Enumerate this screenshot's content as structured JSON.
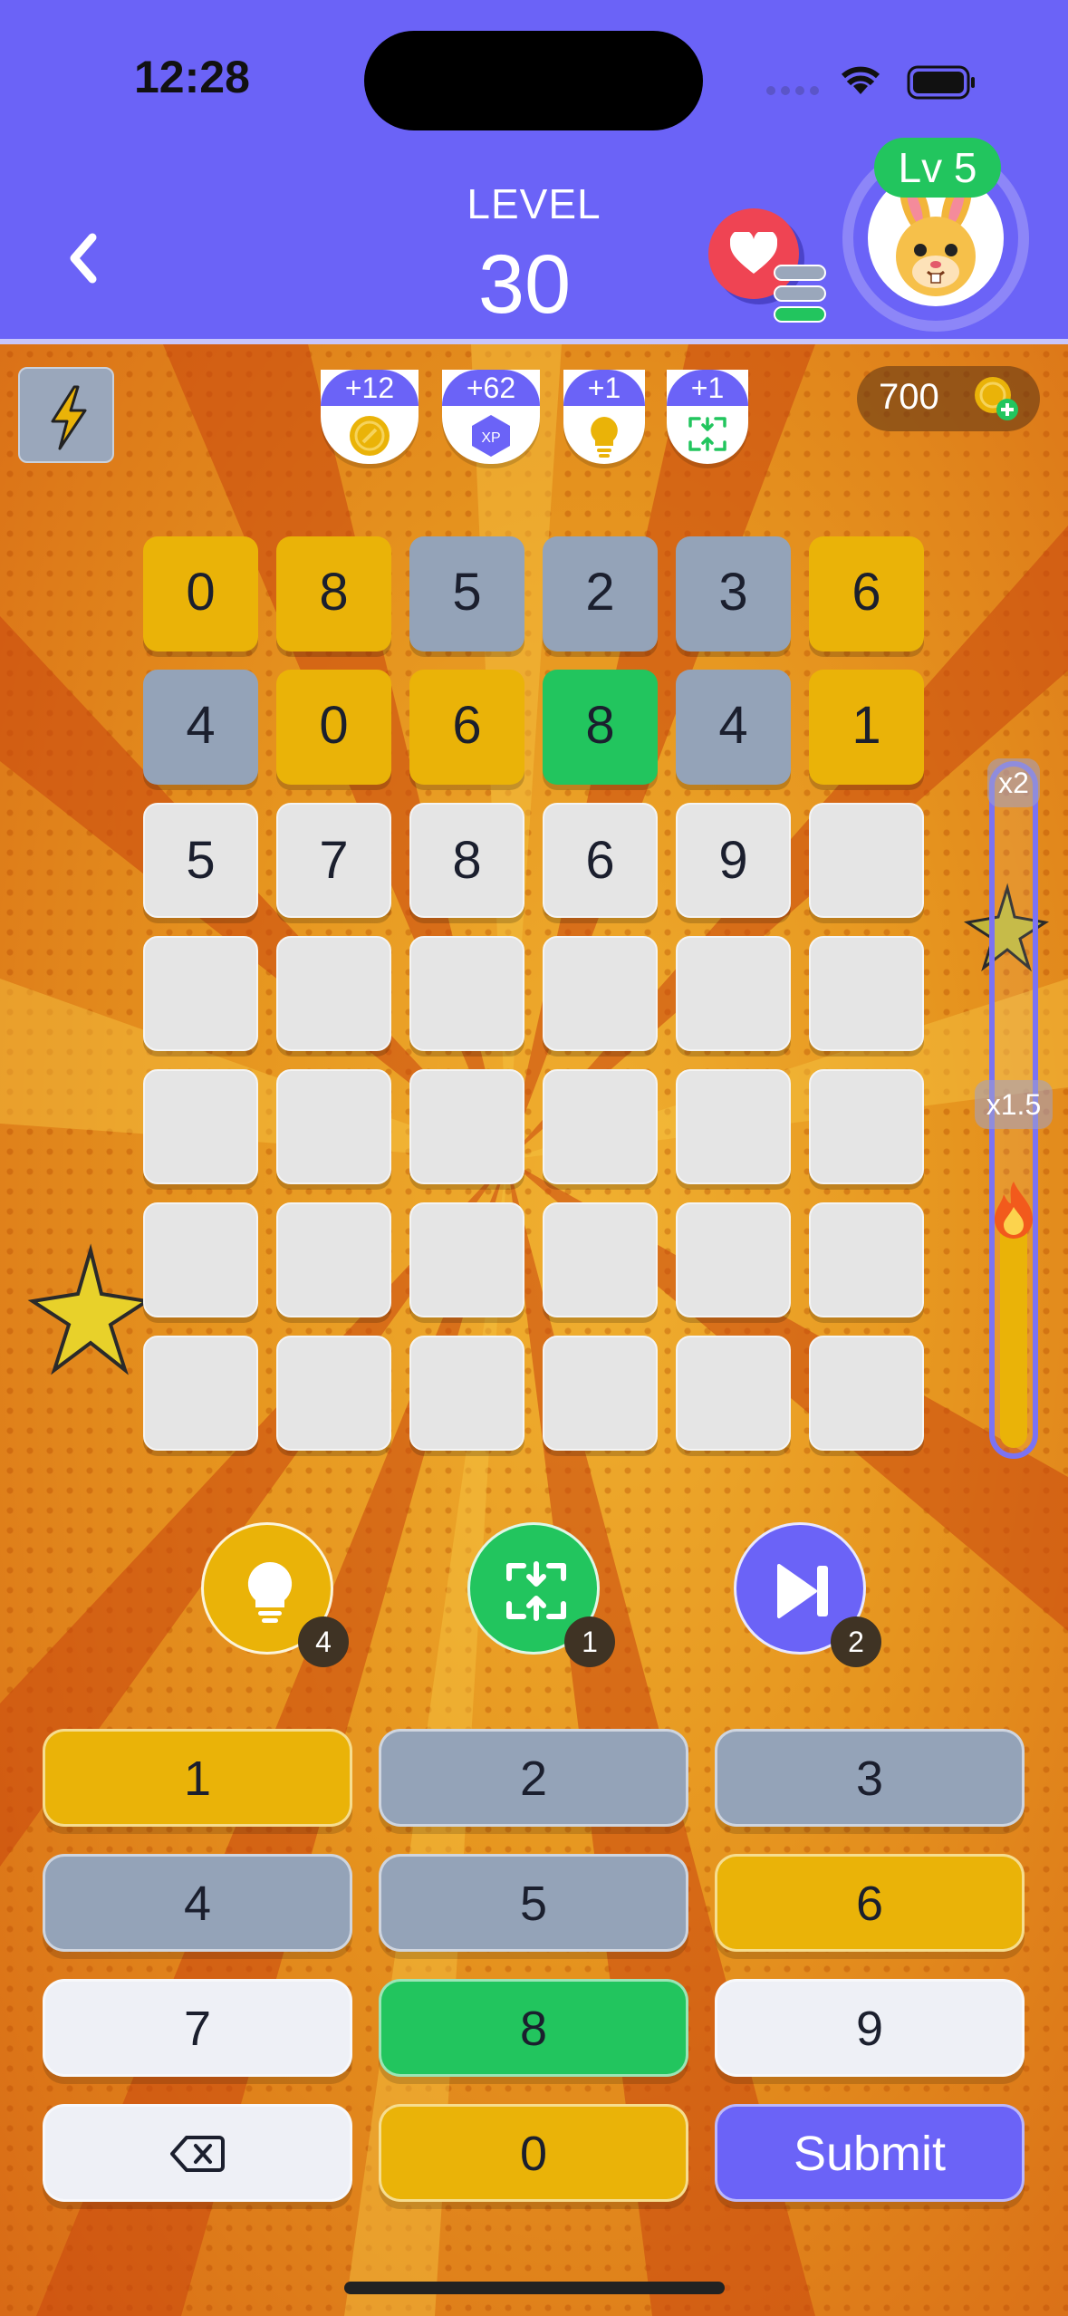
{
  "status_bar": {
    "time": "12:28"
  },
  "header": {
    "level_label": "LEVEL",
    "level_number": "30",
    "player_level": "Lv 5"
  },
  "rewards": [
    {
      "label": "+12",
      "icon": "coin-icon"
    },
    {
      "label": "+62",
      "icon": "xp-icon",
      "icon_text": "XP"
    },
    {
      "label": "+1",
      "icon": "lightbulb-icon"
    },
    {
      "label": "+1",
      "icon": "swap-icon"
    }
  ],
  "coins": {
    "amount": "700"
  },
  "grid": {
    "rows": [
      [
        {
          "v": "0",
          "s": "yellow"
        },
        {
          "v": "8",
          "s": "yellow"
        },
        {
          "v": "5",
          "s": "gray"
        },
        {
          "v": "2",
          "s": "gray"
        },
        {
          "v": "3",
          "s": "gray"
        },
        {
          "v": "6",
          "s": "yellow"
        }
      ],
      [
        {
          "v": "4",
          "s": "gray"
        },
        {
          "v": "0",
          "s": "yellow"
        },
        {
          "v": "6",
          "s": "yellow"
        },
        {
          "v": "8",
          "s": "green"
        },
        {
          "v": "4",
          "s": "gray"
        },
        {
          "v": "1",
          "s": "yellow"
        }
      ],
      [
        {
          "v": "5",
          "s": "empty"
        },
        {
          "v": "7",
          "s": "empty"
        },
        {
          "v": "8",
          "s": "empty"
        },
        {
          "v": "6",
          "s": "empty"
        },
        {
          "v": "9",
          "s": "empty"
        },
        {
          "v": "",
          "s": "empty"
        }
      ],
      [
        {
          "v": "",
          "s": "empty"
        },
        {
          "v": "",
          "s": "empty"
        },
        {
          "v": "",
          "s": "empty"
        },
        {
          "v": "",
          "s": "empty"
        },
        {
          "v": "",
          "s": "empty"
        },
        {
          "v": "",
          "s": "empty"
        }
      ],
      [
        {
          "v": "",
          "s": "empty"
        },
        {
          "v": "",
          "s": "empty"
        },
        {
          "v": "",
          "s": "empty"
        },
        {
          "v": "",
          "s": "empty"
        },
        {
          "v": "",
          "s": "empty"
        },
        {
          "v": "",
          "s": "empty"
        }
      ],
      [
        {
          "v": "",
          "s": "empty"
        },
        {
          "v": "",
          "s": "empty"
        },
        {
          "v": "",
          "s": "empty"
        },
        {
          "v": "",
          "s": "empty"
        },
        {
          "v": "",
          "s": "empty"
        },
        {
          "v": "",
          "s": "empty"
        }
      ],
      [
        {
          "v": "",
          "s": "empty"
        },
        {
          "v": "",
          "s": "empty"
        },
        {
          "v": "",
          "s": "empty"
        },
        {
          "v": "",
          "s": "empty"
        },
        {
          "v": "",
          "s": "empty"
        },
        {
          "v": "",
          "s": "empty"
        }
      ]
    ]
  },
  "multiplier": {
    "top_label": "x2",
    "mid_label": "x1.5",
    "fill_fraction": 0.34,
    "icon": "flame-icon"
  },
  "powerups": [
    {
      "name": "hint",
      "icon": "lightbulb-icon",
      "count": "4",
      "color": "#eab308"
    },
    {
      "name": "swap",
      "icon": "swap-icon",
      "count": "1",
      "color": "#22c55e"
    },
    {
      "name": "skip",
      "icon": "skip-icon",
      "count": "2",
      "color": "#6b63f7"
    }
  ],
  "keypad": {
    "keys": [
      {
        "label": "1",
        "s": "yellow"
      },
      {
        "label": "2",
        "s": "gray"
      },
      {
        "label": "3",
        "s": "gray"
      },
      {
        "label": "4",
        "s": "gray"
      },
      {
        "label": "5",
        "s": "gray"
      },
      {
        "label": "6",
        "s": "yellow"
      },
      {
        "label": "7",
        "s": "white"
      },
      {
        "label": "8",
        "s": "green"
      },
      {
        "label": "9",
        "s": "white"
      },
      {
        "label": "",
        "s": "white",
        "icon": "backspace-icon"
      },
      {
        "label": "0",
        "s": "yellow"
      },
      {
        "label": "Submit",
        "s": "submit"
      }
    ]
  },
  "colors": {
    "header": "#6b63f7",
    "yellow": "#eab308",
    "gray": "#94a3b8",
    "green": "#22c55e"
  }
}
